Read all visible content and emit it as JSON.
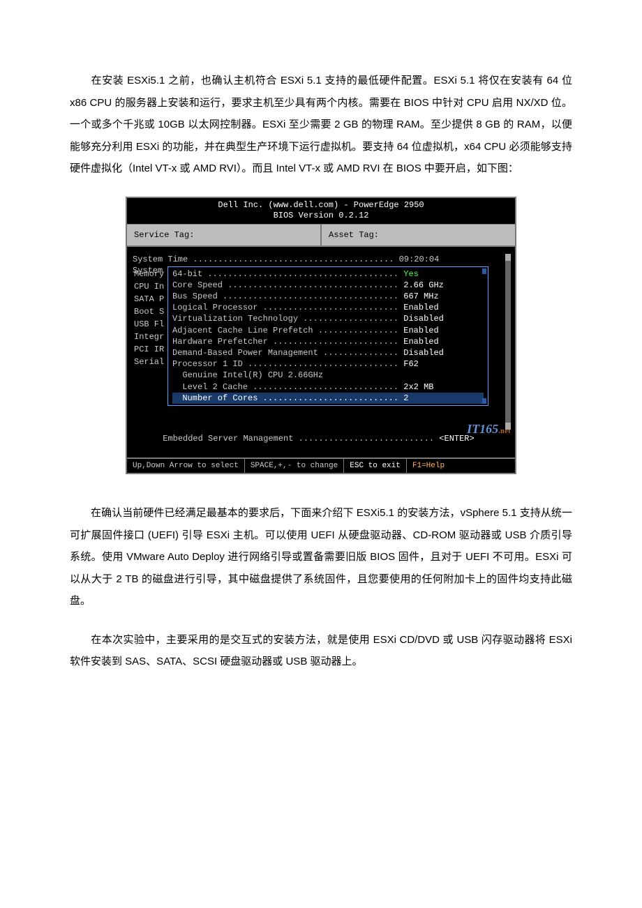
{
  "para1": "在安装 ESXi5.1 之前，也确认主机符合 ESXi 5.1 支持的最低硬件配置。ESXi 5.1 将仅在安装有 64 位 x86 CPU 的服务器上安装和运行，要求主机至少具有两个内核。需要在 BIOS 中针对 CPU 启用 NX/XD 位。一个或多个千兆或 10GB 以太网控制器。ESXi 至少需要 2 GB 的物理 RAM。至少提供 8 GB 的 RAM，以便能够充分利用 ESXi 的功能，并在典型生产环境下运行虚拟机。要支持 64 位虚拟机，x64 CPU 必须能够支持硬件虚拟化（Intel VT-x 或 AMD RVI）。而且 Intel VT-x 或 AMD RVI 在 BIOS 中要开启，如下图：",
  "para2": "在确认当前硬件已经满足最基本的要求后，下面来介绍下 ESXi5.1 的安装方法，vSphere 5.1 支持从统一可扩展固件接口 (UEFI) 引导 ESXi 主机。可以使用 UEFI 从硬盘驱动器、CD-ROM 驱动器或 USB 介质引导系统。使用 VMware Auto Deploy 进行网络引导或置备需要旧版 BIOS 固件，且对于 UEFI 不可用。ESXi 可以从大于 2 TB 的磁盘进行引导，其中磁盘提供了系统固件，且您要使用的任何附加卡上的固件均支持此磁盘。",
  "para3": "在本次实验中，主要采用的是交互式的安装方法，就是使用 ESXi CD/DVD 或 USB 闪存驱动器将 ESXi 软件安装到 SAS、SATA、SCSI 硬盘驱动器或 USB 驱动器上。",
  "bios": {
    "header_line1": "Dell Inc. (www.dell.com) - PowerEdge 2950",
    "header_line2": "BIOS Version 0.2.12",
    "service_tag_label": "Service Tag:",
    "asset_tag_label": "Asset Tag:",
    "system_time_line": "System Time ........................................ 09:20:04",
    "system_label": "System",
    "sidebar": [
      "Memory",
      "CPU In",
      "",
      "SATA P",
      "",
      "Boot S",
      "USB Fl",
      "",
      "Integr",
      "PCI IR",
      "",
      "Serial"
    ],
    "embedded_line": "Embedded Server Management ........................... ",
    "enter_label": "<ENTER>",
    "popup": {
      "rows": [
        {
          "label": "64-bit ...................................... ",
          "val": "Yes",
          "cls": "val-green"
        },
        {
          "label": "Core Speed .................................. ",
          "val": "2.66 GHz",
          "cls": "val-white"
        },
        {
          "label": "Bus Speed ................................... ",
          "val": "667 MHz",
          "cls": "val-white"
        },
        {
          "label": "Logical Processor ........................... ",
          "val": "Enabled",
          "cls": "val-white"
        },
        {
          "label": "Virtualization Technology ................... ",
          "val": "Disabled",
          "cls": "val-white"
        },
        {
          "label": "Adjacent Cache Line Prefetch ................ ",
          "val": "Enabled",
          "cls": "val-white"
        },
        {
          "label": "Hardware Prefetcher ......................... ",
          "val": "Enabled",
          "cls": "val-white"
        },
        {
          "label": "Demand-Based Power Management ............... ",
          "val": "Disabled",
          "cls": "val-white"
        },
        {
          "label": "Processor 1 ID .............................. ",
          "val": "F62",
          "cls": "val-white"
        },
        {
          "label": "  Genuine Intel(R) CPU 2.66GHz",
          "val": "",
          "cls": ""
        },
        {
          "label": "  Level 2 Cache ............................. ",
          "val": "2x2 MB",
          "cls": "val-white"
        },
        {
          "label": "  Number of Cores ........................... ",
          "val": "2",
          "cls": "val-white",
          "hl": true
        }
      ]
    },
    "footer": {
      "nav": "Up,Down Arrow to select",
      "change": "SPACE,+,- to change",
      "esc": "ESC to exit",
      "help": "F1=Help"
    },
    "watermark_main": "IT165",
    "watermark_sub": ".net"
  }
}
